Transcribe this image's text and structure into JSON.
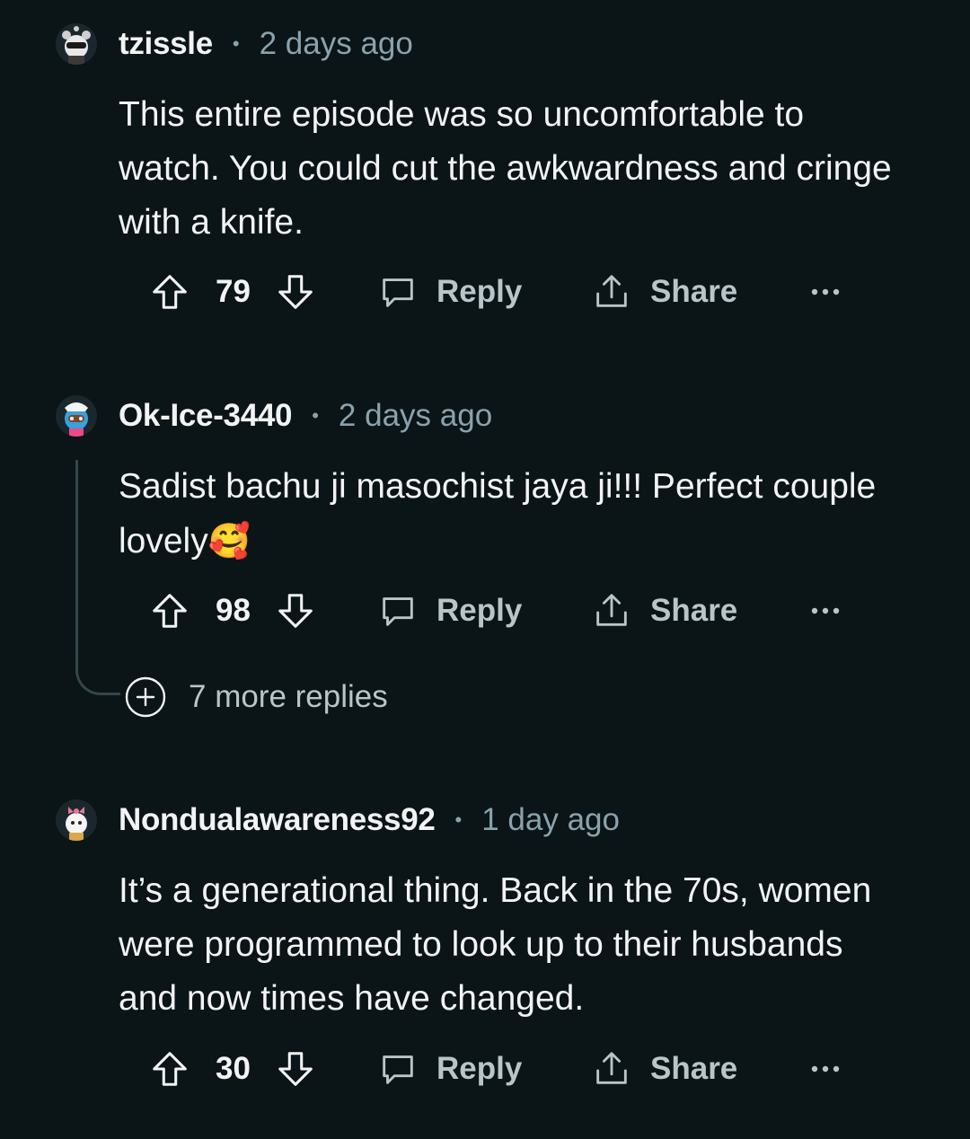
{
  "comments": [
    {
      "username": "tzissle",
      "separator": "•",
      "time": "2 days ago",
      "body": "This entire episode was so uncomfortable to watch. You could cut the awkwardness and cringe with a knife.",
      "score": "79",
      "reply_label": "Reply",
      "share_label": "Share"
    },
    {
      "username": "Ok-Ice-3440",
      "separator": "•",
      "time": "2 days ago",
      "body": "Sadist bachu ji masochist jaya ji!!! Perfect couple lovely",
      "emoji": "🥰",
      "score": "98",
      "reply_label": "Reply",
      "share_label": "Share",
      "more_replies": "7 more replies"
    },
    {
      "username": "Nondualawareness92",
      "separator": "•",
      "time": "1 day ago",
      "body": "It’s a generational thing. Back in the 70s, women were programmed to look up to their husbands and now times have changed.",
      "score": "30",
      "reply_label": "Reply",
      "share_label": "Share"
    }
  ],
  "icons": {
    "upvote": "arrow-up-outline-icon",
    "downvote": "arrow-down-outline-icon",
    "reply": "speech-bubble-icon",
    "share": "share-upload-icon",
    "more": "ellipsis-icon",
    "expand": "plus-circle-icon"
  },
  "colors": {
    "background": "#0b1416",
    "text": "#f2f3f4",
    "secondary_text": "#8ba2ad",
    "action_text": "#b8c5c9",
    "thread_line": "#33464c"
  }
}
